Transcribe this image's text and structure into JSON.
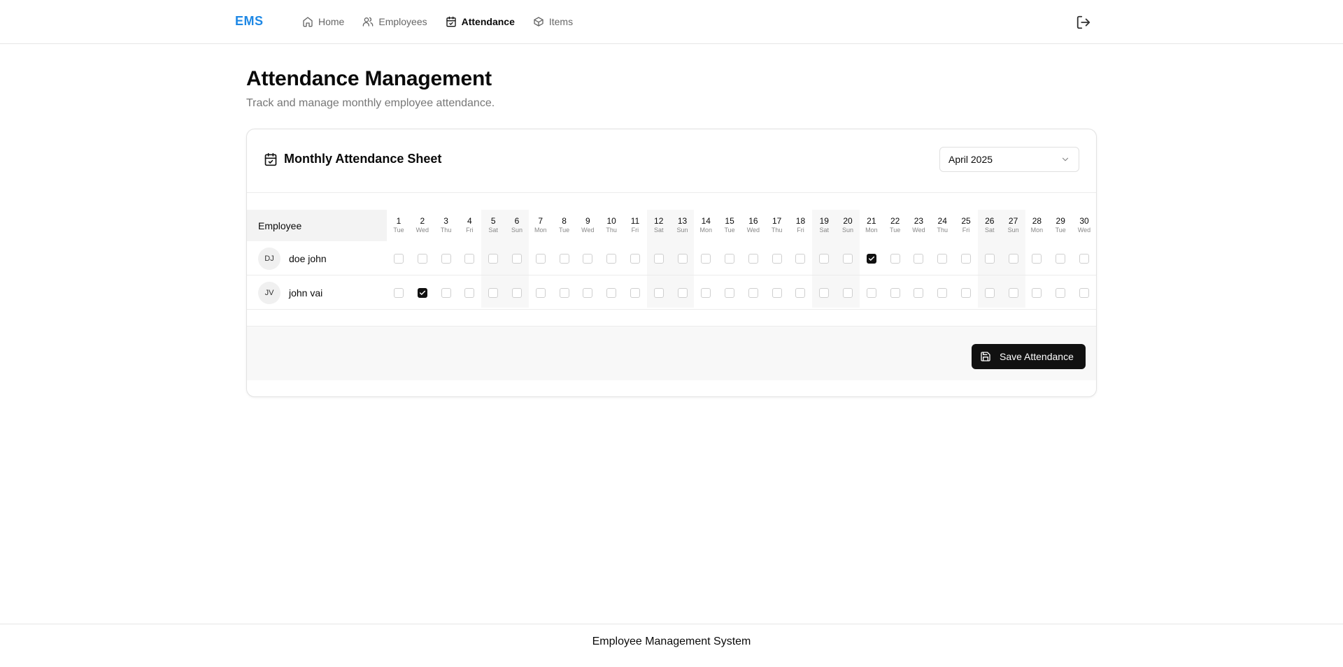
{
  "app": {
    "brand": "EMS",
    "footer": "Employee Management System"
  },
  "nav": [
    {
      "label": "Home",
      "icon": "home-icon",
      "active": false
    },
    {
      "label": "Employees",
      "icon": "users-icon",
      "active": false
    },
    {
      "label": "Attendance",
      "icon": "calendar-check-icon",
      "active": true
    },
    {
      "label": "Items",
      "icon": "box-icon",
      "active": false
    }
  ],
  "page": {
    "title": "Attendance Management",
    "subtitle": "Track and manage monthly employee attendance."
  },
  "sheet": {
    "title": "Monthly Attendance Sheet",
    "month": "April 2025",
    "employee_header": "Employee",
    "days": [
      {
        "d": "1",
        "w": "Tue"
      },
      {
        "d": "2",
        "w": "Wed"
      },
      {
        "d": "3",
        "w": "Thu"
      },
      {
        "d": "4",
        "w": "Fri"
      },
      {
        "d": "5",
        "w": "Sat"
      },
      {
        "d": "6",
        "w": "Sun"
      },
      {
        "d": "7",
        "w": "Mon"
      },
      {
        "d": "8",
        "w": "Tue"
      },
      {
        "d": "9",
        "w": "Wed"
      },
      {
        "d": "10",
        "w": "Thu"
      },
      {
        "d": "11",
        "w": "Fri"
      },
      {
        "d": "12",
        "w": "Sat"
      },
      {
        "d": "13",
        "w": "Sun"
      },
      {
        "d": "14",
        "w": "Mon"
      },
      {
        "d": "15",
        "w": "Tue"
      },
      {
        "d": "16",
        "w": "Wed"
      },
      {
        "d": "17",
        "w": "Thu"
      },
      {
        "d": "18",
        "w": "Fri"
      },
      {
        "d": "19",
        "w": "Sat"
      },
      {
        "d": "20",
        "w": "Sun"
      },
      {
        "d": "21",
        "w": "Mon"
      },
      {
        "d": "22",
        "w": "Tue"
      },
      {
        "d": "23",
        "w": "Wed"
      },
      {
        "d": "24",
        "w": "Thu"
      },
      {
        "d": "25",
        "w": "Fri"
      },
      {
        "d": "26",
        "w": "Sat"
      },
      {
        "d": "27",
        "w": "Sun"
      },
      {
        "d": "28",
        "w": "Mon"
      },
      {
        "d": "29",
        "w": "Tue"
      },
      {
        "d": "30",
        "w": "Wed"
      }
    ],
    "employees": [
      {
        "initials": "DJ",
        "name": "doe john",
        "present_days": [
          "21"
        ]
      },
      {
        "initials": "JV",
        "name": "john vai",
        "present_days": [
          "2"
        ]
      }
    ],
    "save_label": "Save Attendance"
  }
}
